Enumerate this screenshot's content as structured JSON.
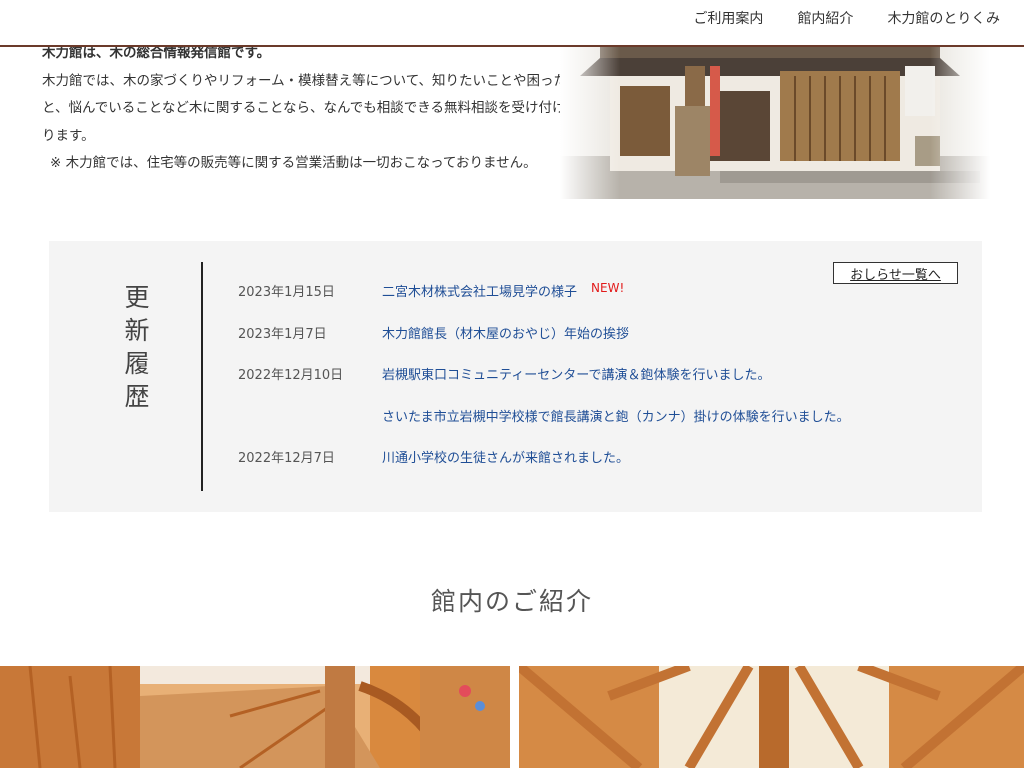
{
  "header": {
    "nav": [
      "ご利用案内",
      "館内紹介",
      "木力館のとりくみ"
    ]
  },
  "intro": {
    "lead": "木力館は、木の総合情報発信館です。",
    "body_1": "木力館では、木の家づくりやリフォーム・模様替え等について、知りたいことや困ったこと、悩んでいることなど木に関することなら、なんでも相談できる無料相談を受け付けております。",
    "note": "※ 木力館では、住宅等の販売等に関する営業活動は一切おこなっておりません。"
  },
  "news": {
    "title_chars": [
      "更",
      "新",
      "履",
      "歴"
    ],
    "button": "おしらせ一覧へ",
    "new_badge": "NEW!",
    "items": [
      {
        "date": "2023年1月15日",
        "text": "二宮木材株式会社工場見学の様子"
      },
      {
        "date": "2023年1月7日",
        "text": "木力館館長（材木屋のおやじ）年始の挨拶"
      },
      {
        "date": "2022年12月10日",
        "text": "岩槻駅東口コミュニティーセンターで講演＆鉋体験を行いました。"
      },
      {
        "date": "",
        "text": "さいたま市立岩槻中学校様で館長講演と鉋（カンナ）掛けの体験を行いました。"
      },
      {
        "date": "2022年12月7日",
        "text": "川通小学校の生徒さんが来館されました。"
      }
    ]
  },
  "section": {
    "title": "館内のご紹介"
  },
  "colors": {
    "accent": "#6b3a2a",
    "link": "#1f4e96",
    "new": "#e21a1a",
    "news_bg": "#f4f4f4"
  }
}
